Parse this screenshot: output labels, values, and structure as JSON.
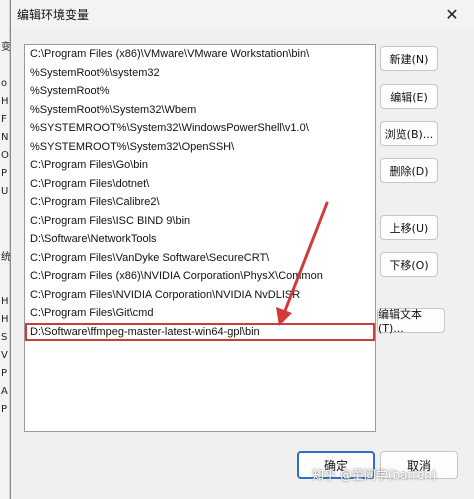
{
  "dialog": {
    "title": "编辑环境变量",
    "close_symbol": "✕"
  },
  "paths": [
    "C:\\Program Files (x86)\\VMware\\VMware Workstation\\bin\\",
    "%SystemRoot%\\system32",
    "%SystemRoot%",
    "%SystemRoot%\\System32\\Wbem",
    "%SYSTEMROOT%\\System32\\WindowsPowerShell\\v1.0\\",
    "%SYSTEMROOT%\\System32\\OpenSSH\\",
    "C:\\Program Files\\Go\\bin",
    "C:\\Program Files\\dotnet\\",
    "C:\\Program Files\\Calibre2\\",
    "C:\\Program Files\\ISC BIND 9\\bin",
    "D:\\Software\\NetworkTools",
    "C:\\Program Files\\VanDyke Software\\SecureCRT\\",
    "C:\\Program Files (x86)\\NVIDIA Corporation\\PhysX\\Common",
    "C:\\Program Files\\NVIDIA Corporation\\NVIDIA NvDLISR",
    "C:\\Program Files\\Git\\cmd",
    "D:\\Software\\ffmpeg-master-latest-win64-gpl\\bin"
  ],
  "buttons": {
    "new": "新建(N)",
    "edit": "编辑(E)",
    "browse": "浏览(B)...",
    "delete": "删除(D)",
    "move_up": "上移(U)",
    "move_down": "下移(O)",
    "edit_text": "编辑文本(T)...",
    "ok": "确定",
    "cancel": "取消"
  },
  "watermark": "知乎 @董同学(barren)",
  "annotation_color": "#d23a3a",
  "background_window_chars": [
    "变",
    "o",
    "H",
    "F",
    "N",
    "O",
    "P",
    "U",
    "统",
    "H",
    "H",
    "S",
    "V",
    "P",
    "A",
    "P"
  ]
}
